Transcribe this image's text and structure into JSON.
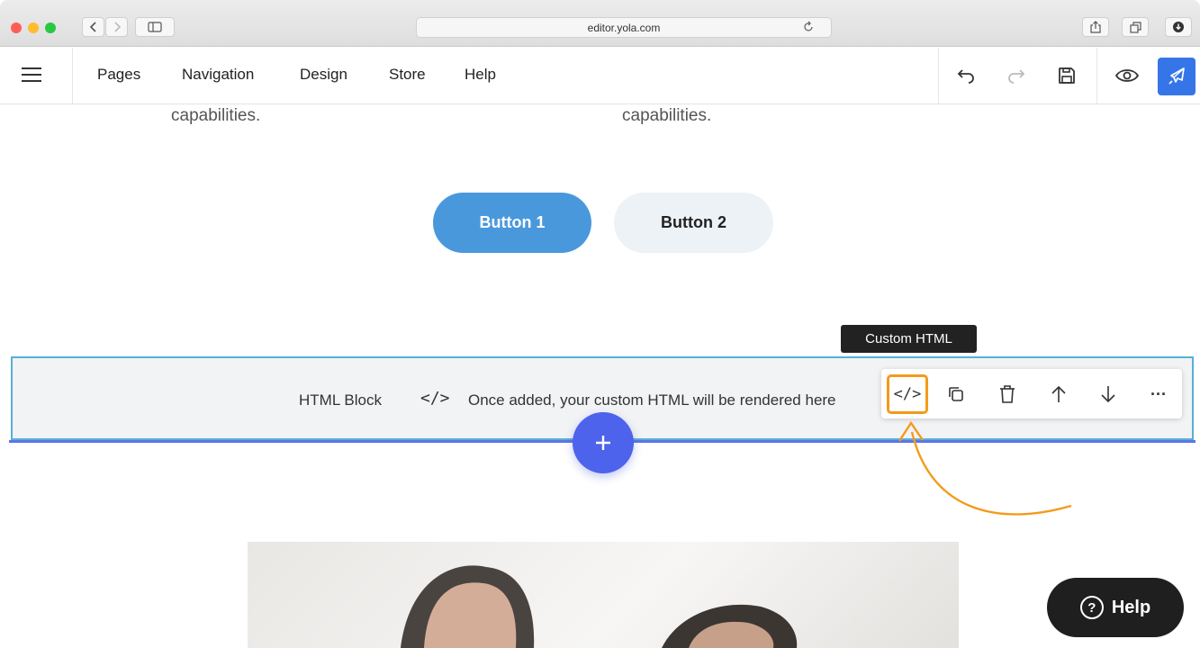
{
  "browser": {
    "url": "editor.yola.com"
  },
  "menu": {
    "items": [
      {
        "label": "Pages"
      },
      {
        "label": "Navigation"
      },
      {
        "label": "Design"
      },
      {
        "label": "Store"
      },
      {
        "label": "Help"
      }
    ],
    "tool_icons": [
      "undo-icon",
      "redo-icon",
      "save-icon",
      "preview-eye-icon",
      "publish-rocket-icon"
    ]
  },
  "content": {
    "left_text": "capabilities.",
    "right_text": "capabilities.",
    "button1_label": "Button 1",
    "button2_label": "Button 2"
  },
  "html_block": {
    "label": "HTML Block",
    "code_glyph": "</>",
    "description": "Once added, your custom HTML will be rendered here"
  },
  "tooltip": {
    "text": "Custom HTML"
  },
  "block_toolbar": {
    "code_glyph": "</>",
    "more_glyph": "···",
    "icons": [
      "custom-html-icon",
      "duplicate-icon",
      "delete-icon",
      "move-up-icon",
      "move-down-icon",
      "more-icon"
    ]
  },
  "help_widget": {
    "label": "Help",
    "glyph": "?"
  },
  "colors": {
    "accent": "#3575e8",
    "button1": "#4a98dc",
    "add_button": "#4d63ec",
    "highlight": "#f39b1a",
    "block_border": "#58b0d6"
  }
}
